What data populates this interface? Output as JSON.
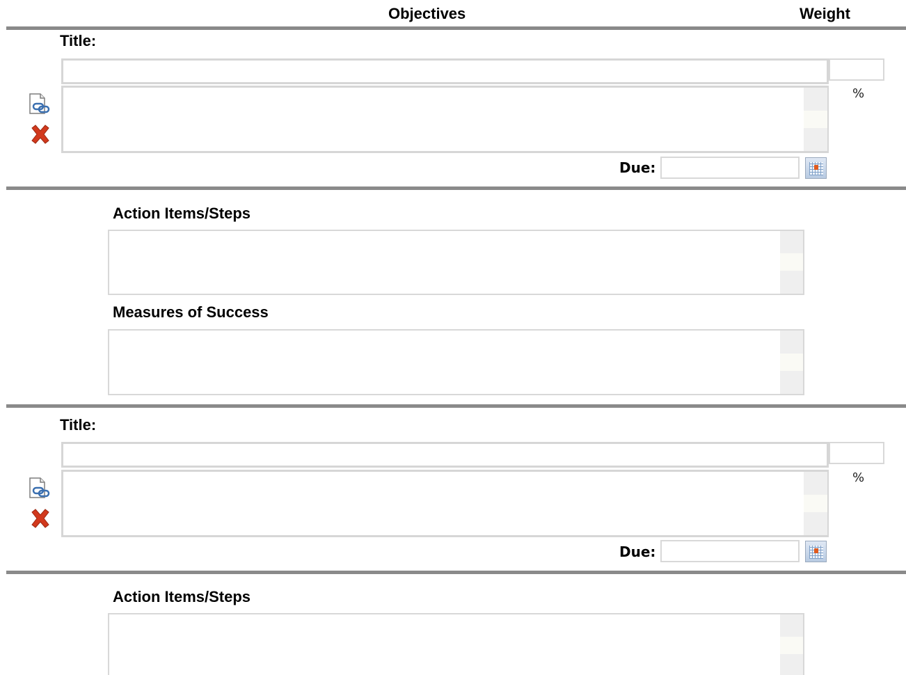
{
  "header": {
    "objectives": "Objectives",
    "weight": "Weight"
  },
  "objectives": [
    {
      "title_label": "Title:",
      "title_value": "",
      "weight_value": "",
      "percent": "%",
      "description_value": "",
      "due_label": "Due:",
      "due_value": "",
      "action_label": "Action Items/Steps",
      "action_value": "",
      "measures_label": "Measures of Success",
      "measures_value": ""
    },
    {
      "title_label": "Title:",
      "title_value": "",
      "weight_value": "",
      "percent": "%",
      "description_value": "",
      "due_label": "Due:",
      "due_value": "",
      "action_label": "Action Items/Steps",
      "action_value": ""
    }
  ],
  "icons": {
    "attach": "document-link-icon",
    "delete": "delete-x-icon",
    "calendar": "calendar-icon"
  },
  "colors": {
    "rule": "#8a8a8a",
    "border": "#d6d6d6",
    "delete": "#d2391d"
  }
}
